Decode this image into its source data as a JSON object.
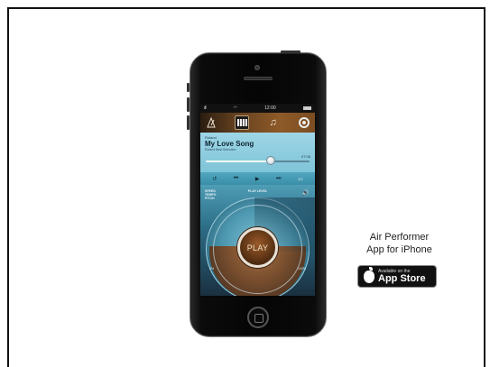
{
  "app": {
    "status_time": "12:00",
    "signal": "ıll",
    "wifi": "◠",
    "toolbar": {
      "icons": [
        "metronome-icon",
        "keyboard-icon",
        "music-note-icon",
        "settings-icon"
      ]
    },
    "song": {
      "artist": "Roland",
      "title": "My Love Song",
      "subtitle": "Roland Best Selection",
      "time_end": "07:06",
      "progress": 0.63
    },
    "transport": {
      "repeat": "↺",
      "prev": "⏮",
      "play": "▶",
      "next": "⏭",
      "track_count": "1/1"
    },
    "dial": {
      "speed_label": "SPEED\nTEMPO\nPITCH",
      "play_level_label": "PLAY LEVEL",
      "volume_icon": "🔊",
      "play_label": "PLAY",
      "pct_left": "0%",
      "pct_right": "100%"
    }
  },
  "caption": {
    "line1": "Air Performer",
    "line2": "App for iPhone"
  },
  "badge": {
    "small": "Available on the",
    "big": "App Store"
  },
  "colors": {
    "toolbar_brown": "#8e5a28",
    "panel_blue": "#7fc4d8",
    "dial_blue": "#4d98b0",
    "play_brown": "#5a3214"
  }
}
